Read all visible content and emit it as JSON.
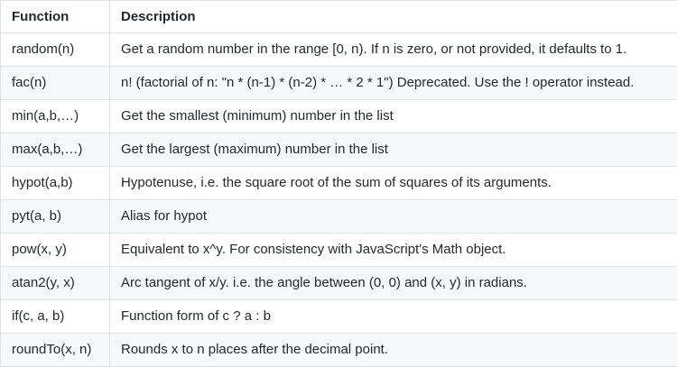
{
  "table": {
    "headers": [
      "Function",
      "Description"
    ],
    "rows": [
      {
        "function": "random(n)",
        "description": "Get a random number in the range [0, n). If n is zero, or not provided, it defaults to 1."
      },
      {
        "function": "fac(n)",
        "description": "n! (factorial of n: \"n * (n-1) * (n-2) * … * 2 * 1\") Deprecated. Use the ! operator instead."
      },
      {
        "function": "min(a,b,…)",
        "description": "Get the smallest (minimum) number in the list"
      },
      {
        "function": "max(a,b,…)",
        "description": "Get the largest (maximum) number in the list"
      },
      {
        "function": "hypot(a,b)",
        "description": "Hypotenuse, i.e. the square root of the sum of squares of its arguments."
      },
      {
        "function": "pyt(a, b)",
        "description": "Alias for hypot"
      },
      {
        "function": "pow(x, y)",
        "description": "Equivalent to x^y. For consistency with JavaScript's Math object."
      },
      {
        "function": "atan2(y, x)",
        "description": "Arc tangent of x/y. i.e. the angle between (0, 0) and (x, y) in radians."
      },
      {
        "function": "if(c, a, b)",
        "description": "Function form of c ? a : b"
      },
      {
        "function": "roundTo(x, n)",
        "description": "Rounds x to n places after the decimal point."
      }
    ]
  }
}
